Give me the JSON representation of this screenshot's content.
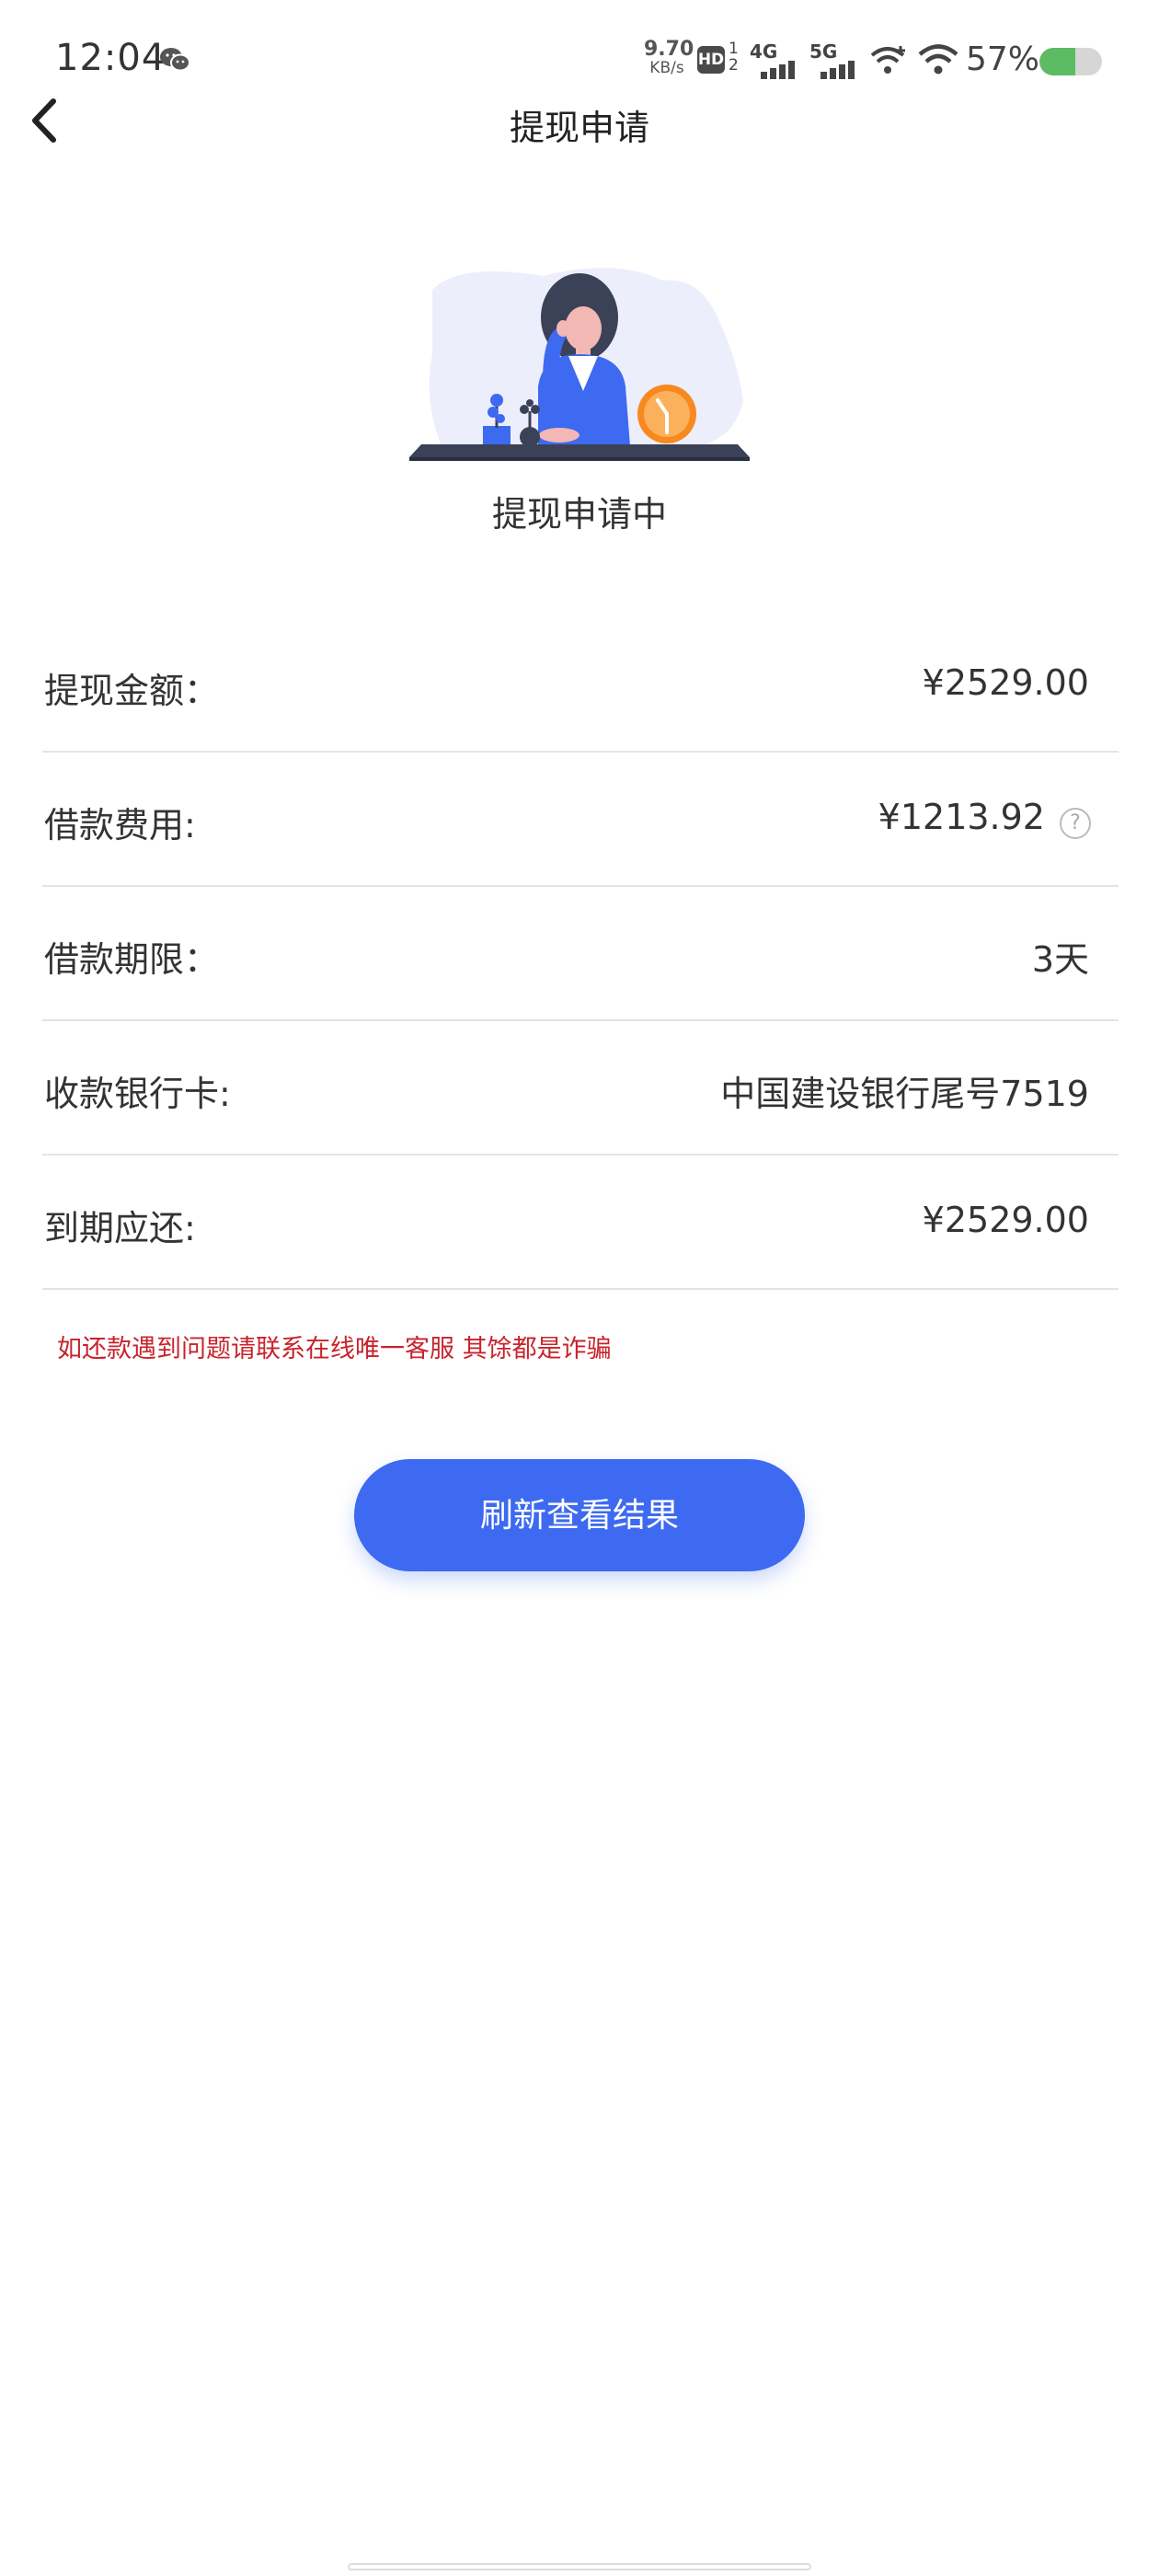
{
  "status_bar": {
    "time": "12:04",
    "net_speed_value": "9.70",
    "net_speed_unit": "KB/s",
    "hd_badge": "HD",
    "hd_num": "1",
    "hd_sub": "2",
    "signal_1": "4G",
    "signal_2": "5G",
    "battery_pct": "57%",
    "battery_level": 0.57,
    "icons": [
      "wechat-icon",
      "wifi-plus-icon",
      "wifi-icon",
      "battery-icon"
    ]
  },
  "nav": {
    "title": "提现申请",
    "back_icon": "chevron-left-icon"
  },
  "status": {
    "text": "提现申请中"
  },
  "info": {
    "rows": [
      {
        "label": "提现金额：",
        "value": "¥2529.00"
      },
      {
        "label": "借款费用:",
        "value": "¥1213.92",
        "help": "?"
      },
      {
        "label": "借款期限：",
        "value": "3天"
      },
      {
        "label": "收款银行卡:",
        "value": "中国建设银行尾号7519"
      },
      {
        "label": "到期应还:",
        "value": "¥2529.00"
      }
    ]
  },
  "warning": "如还款遇到问题请联系在线唯一客服 其馀都是诈骗",
  "refresh_button": "刷新查看结果",
  "colors": {
    "accent": "#3d6af0",
    "warning": "#c8232c",
    "divider": "#e4e4e4",
    "battery": "#5dbb63"
  }
}
